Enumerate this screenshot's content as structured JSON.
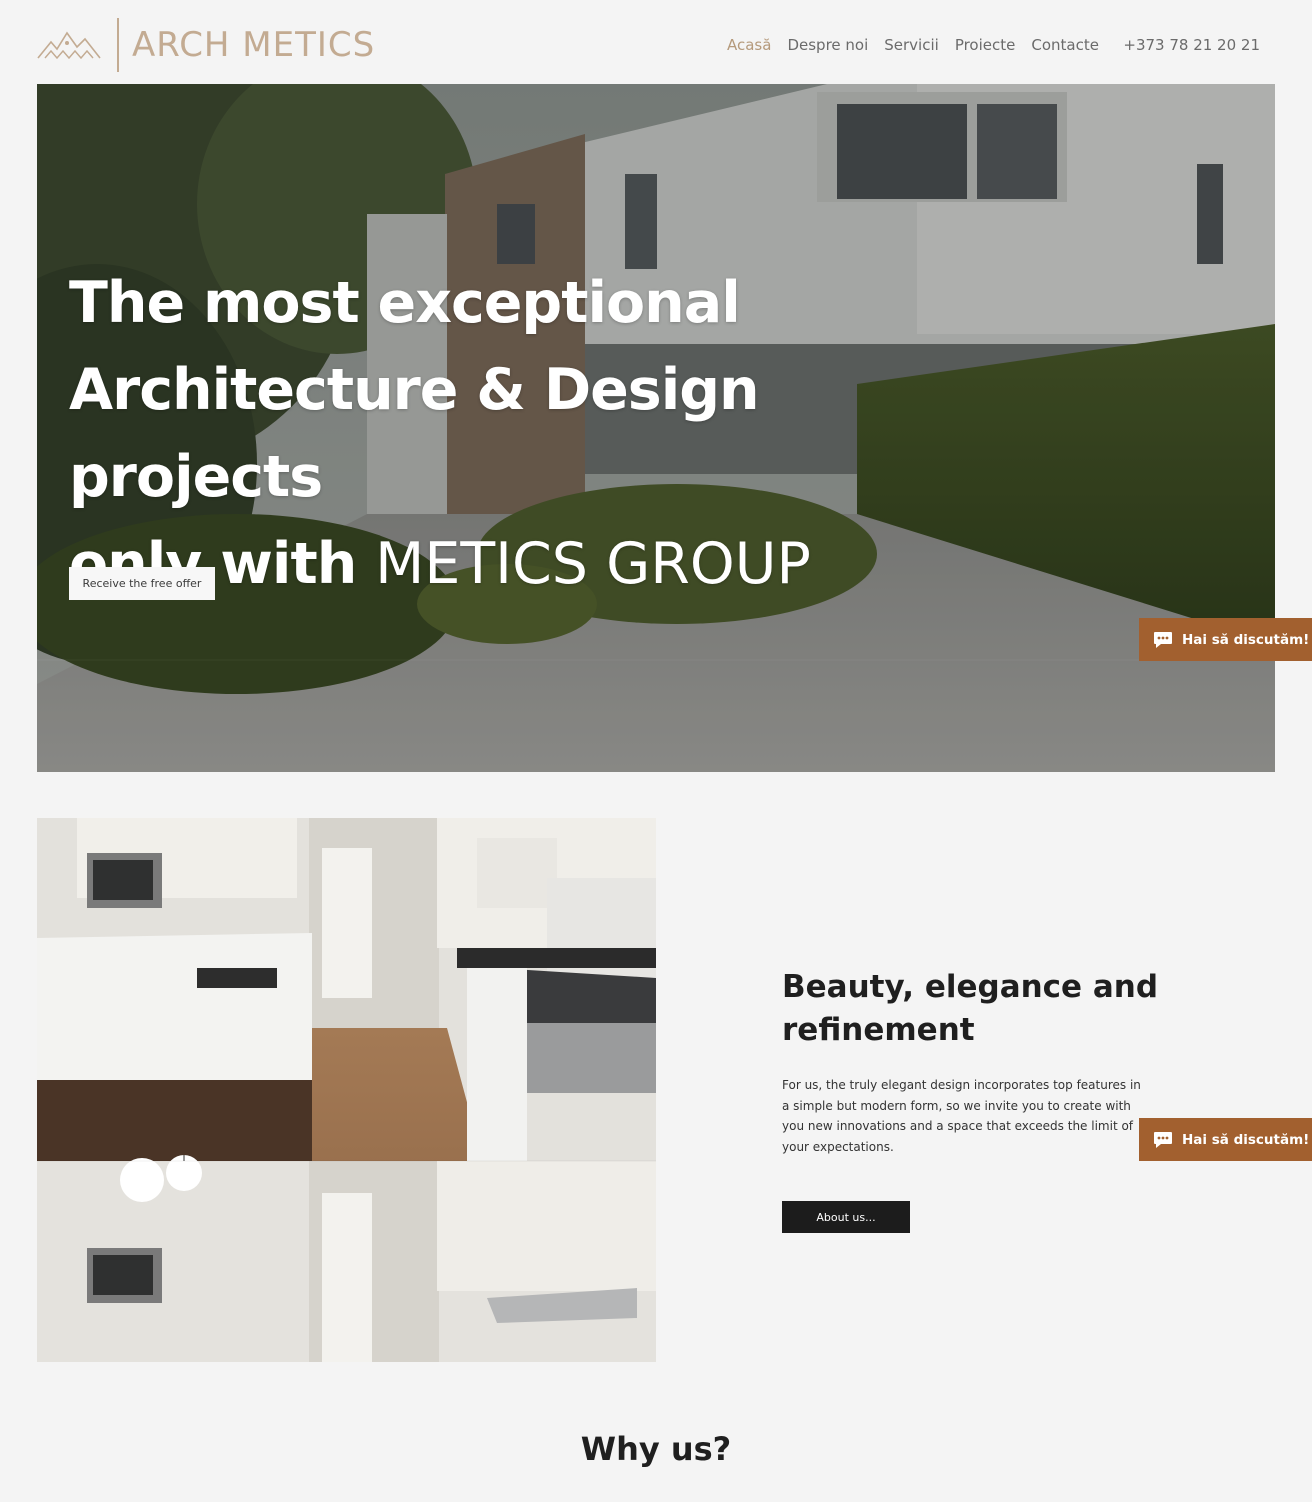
{
  "brand": {
    "name": "ARCH METICS",
    "accent_color": "#c3ab92"
  },
  "nav": {
    "items": [
      {
        "label": "Acasă",
        "active": true
      },
      {
        "label": "Despre noi",
        "active": false
      },
      {
        "label": "Servicii",
        "active": false
      },
      {
        "label": "Proiecte",
        "active": false
      },
      {
        "label": "Contacte",
        "active": false
      }
    ],
    "phone": "+373 78 21 20 21",
    "text_color": "#6b6b6b",
    "active_color": "#b59a7c"
  },
  "hero": {
    "title_line1": "The most exceptional",
    "title_line2": "Architecture & Design projects",
    "title_line3_bold": "only with",
    "title_line3_light": "METICS GROUP",
    "cta_label": "Receive the free offer",
    "image": "modern-house-photo"
  },
  "chat": {
    "label": "Hai să discutăm!",
    "icon": "chat-bubble-icon",
    "color": "#a2602f"
  },
  "about": {
    "image": "kitchen-interior-photo",
    "title": "Beauty, elegance and refinement",
    "text": "For us, the truly elegant design incorporates top features in a simple but modern form, so we invite you to create with you new innovations and a space that exceeds the limit of your expectations.",
    "button_label": "About us..."
  },
  "why": {
    "title": "Why us?"
  }
}
